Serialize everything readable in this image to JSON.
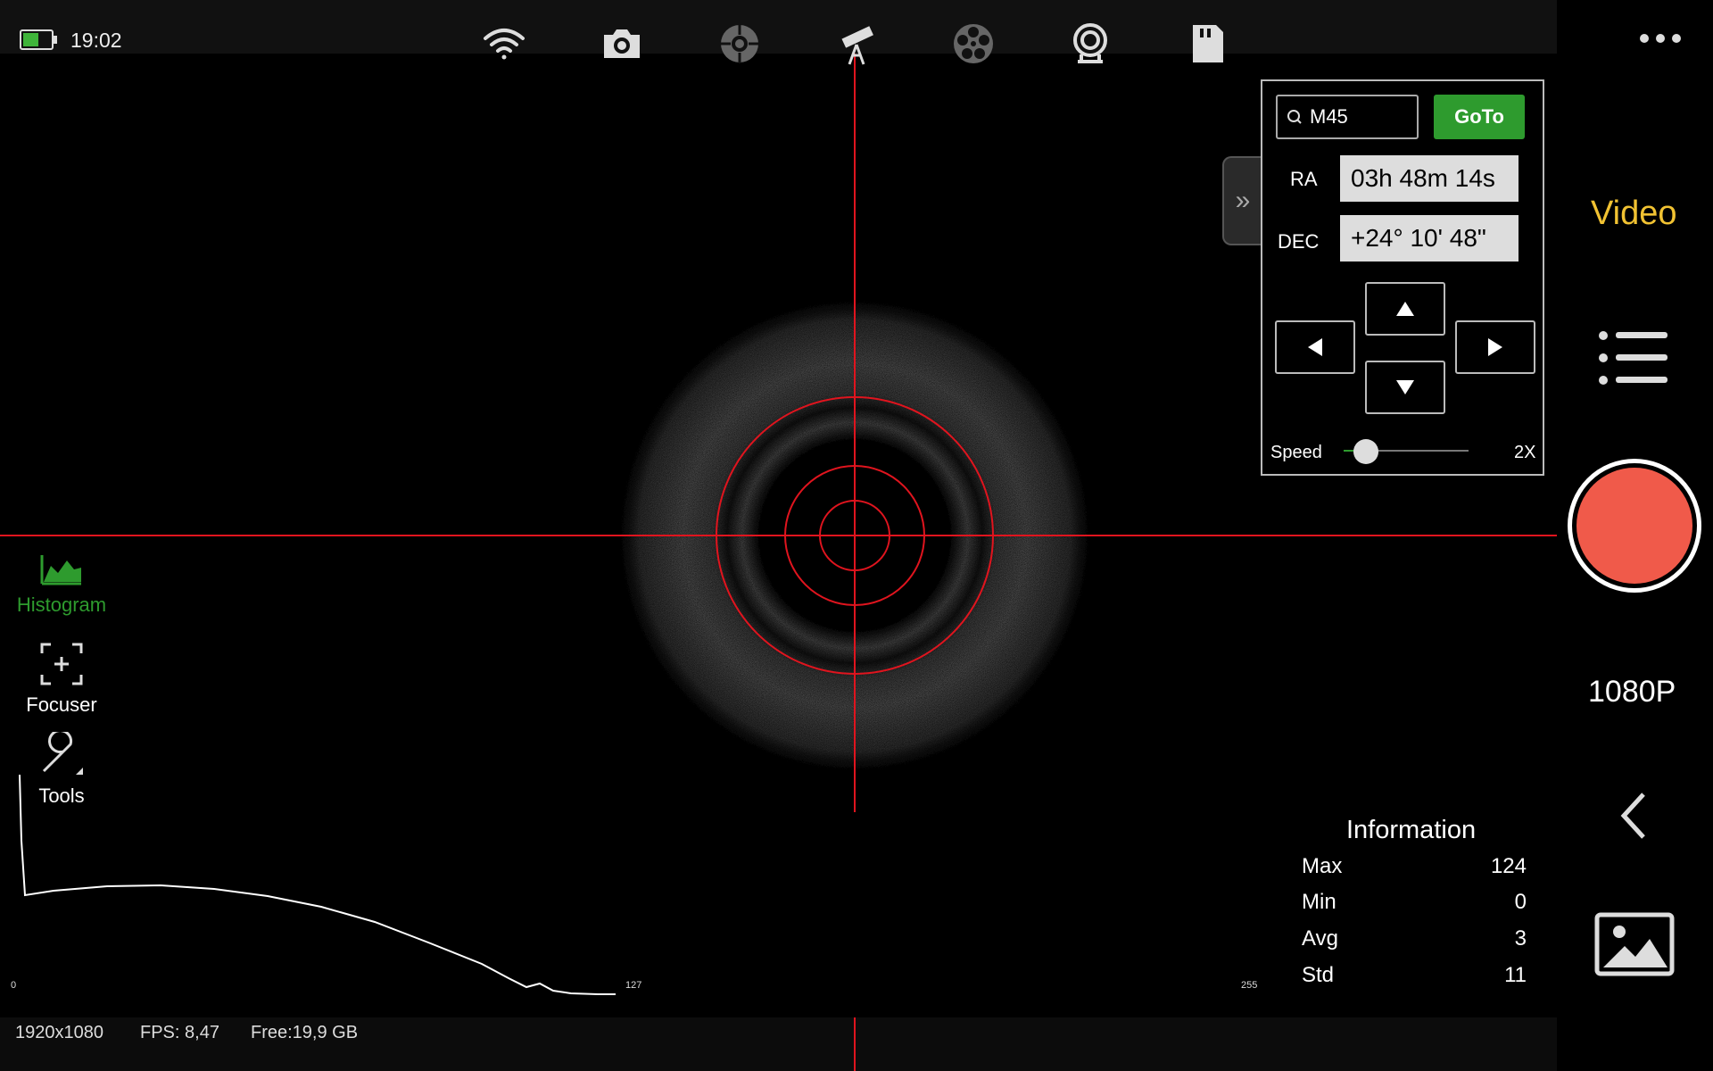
{
  "status": {
    "time": "19:02"
  },
  "toolbar": {
    "icons": [
      "wifi-icon",
      "camera-icon",
      "crosshair-icon",
      "telescope-icon",
      "filter-wheel-icon",
      "focuser-device-icon",
      "sd-card-icon"
    ],
    "more_icon": "more-icon"
  },
  "goto": {
    "search_value": "M45",
    "goto_label": "GoTo",
    "ra_label": "RA",
    "ra_value": "03h 48m 14s",
    "dec_label": "DEC",
    "dec_value": "+24° 10' 48\"",
    "speed_label": "Speed",
    "speed_value": "2X",
    "speed_level": 0.1
  },
  "right": {
    "mode": "Video",
    "resolution": "1080P"
  },
  "tools": {
    "histogram": "Histogram",
    "focuser": "Focuser",
    "tools": "Tools"
  },
  "histogram": {
    "tick_min": "0",
    "tick_mid": "127",
    "tick_max": "255"
  },
  "information": {
    "title": "Information",
    "rows": [
      {
        "label": "Max",
        "value": "124"
      },
      {
        "label": "Min",
        "value": "0"
      },
      {
        "label": "Avg",
        "value": "3"
      },
      {
        "label": "Std",
        "value": "11"
      }
    ]
  },
  "footer": {
    "resolution": "1920x1080",
    "fps": "FPS: 8,47",
    "free": "Free:19,9 GB"
  },
  "colors": {
    "accent_green": "#2e9b2e",
    "mode_yellow": "#f1c232",
    "record_red": "#f05a4a",
    "reticle_red": "#e0141e"
  }
}
